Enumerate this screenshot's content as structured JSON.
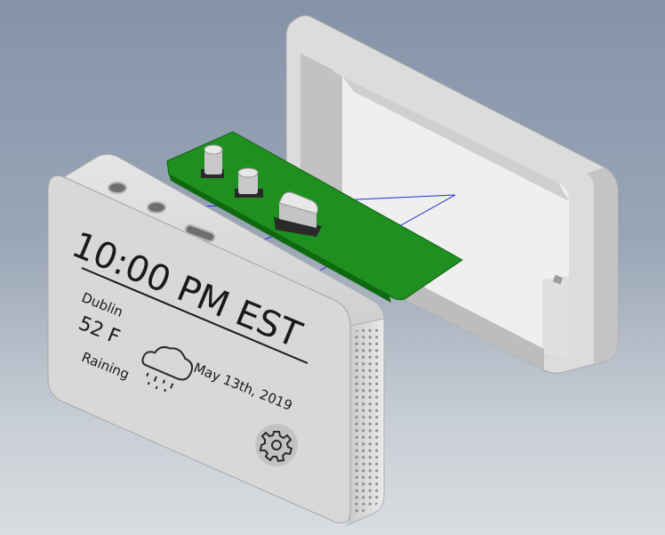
{
  "display": {
    "time": "10:00 PM EST",
    "city": "Dublin",
    "temperature": "52 F",
    "condition": "Raining",
    "date": "May 13th, 2019"
  },
  "icons": {
    "weather": "rain-cloud-icon",
    "settings": "gear-icon"
  },
  "colors": {
    "enclosure": "#d5d5d5",
    "pcb": "#1f8f1f",
    "background_top": "#8593a9",
    "background_bottom": "#d9dde1",
    "axis_line": "#1f2fd8"
  }
}
